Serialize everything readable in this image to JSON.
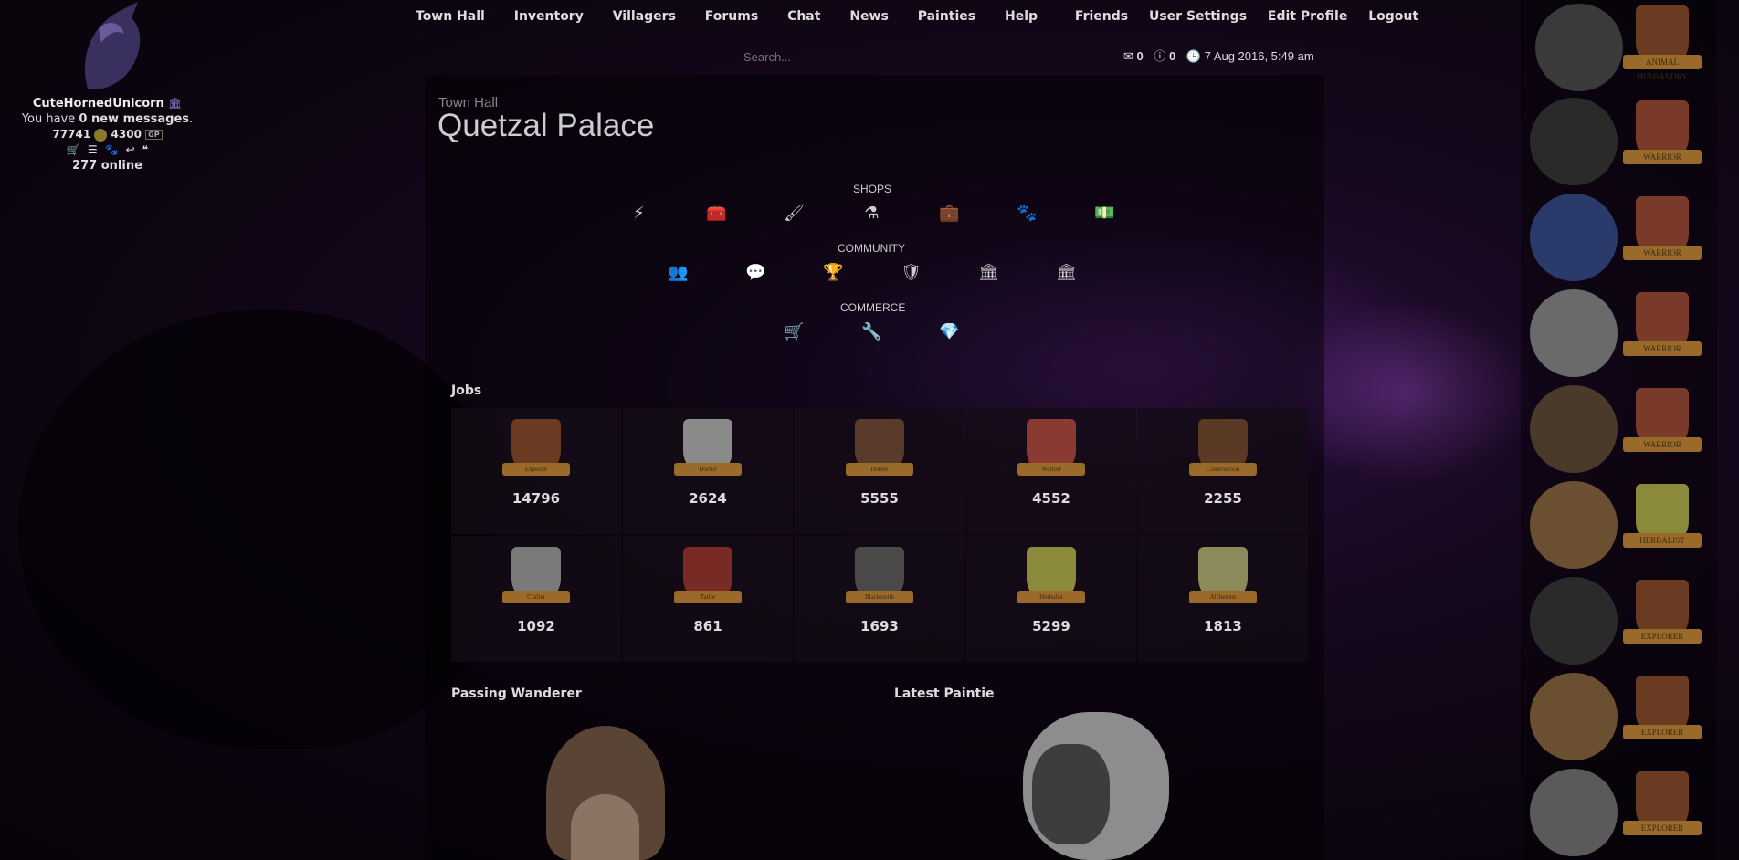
{
  "user_panel": {
    "username": "CuteHornedUnicorn",
    "messages_prefix": "You have ",
    "messages_bold": "0 new messages",
    "messages_suffix": ".",
    "coins": "77741",
    "gems": "4300",
    "gem_badge": "GP",
    "online": "277 online"
  },
  "nav": {
    "items": [
      "Town Hall",
      "Inventory",
      "Villagers",
      "Forums",
      "Chat",
      "News",
      "Painties",
      "Help"
    ],
    "right_items": [
      "Friends",
      "User Settings",
      "Edit Profile",
      "Logout"
    ]
  },
  "search": {
    "placeholder": "Search..."
  },
  "status": {
    "mail_count": "0",
    "alert_count": "0",
    "datetime": "7 Aug 2016, 5:49 am"
  },
  "breadcrumb": "Town Hall",
  "title": "Quetzal Palace",
  "sections": {
    "shops": "SHOPS",
    "community": "COMMUNITY",
    "commerce": "COMMERCE"
  },
  "shop_icons": [
    "bolt-icon",
    "medkit-icon",
    "paintbrush-icon",
    "flask-icon",
    "briefcase-icon",
    "paw-icon",
    "money-icon"
  ],
  "community_icons": [
    "users-icon",
    "comment-icon",
    "trophy-icon",
    "shield-icon",
    "bank-icon",
    "bank-icon"
  ],
  "commerce_icons": [
    "cart-icon",
    "wrench-icon",
    "diamond-icon"
  ],
  "jobs": {
    "title": "Jobs",
    "items": [
      {
        "name": "Explorer",
        "count": "14796",
        "color": "#6a3a22"
      },
      {
        "name": "Doctor",
        "count": "2624",
        "color": "#8a8a8a"
      },
      {
        "name": "Hobby",
        "count": "5555",
        "color": "#5a3a2a"
      },
      {
        "name": "Warrior",
        "count": "4552",
        "color": "#8a3a30"
      },
      {
        "name": "Construction",
        "count": "2255",
        "color": "#5a3a25"
      },
      {
        "name": "Crafter",
        "count": "1092",
        "color": "#7a7a7a"
      },
      {
        "name": "Tailor",
        "count": "861",
        "color": "#7a2a25"
      },
      {
        "name": "Blacksmith",
        "count": "1693",
        "color": "#4a4a4a"
      },
      {
        "name": "Herbalist",
        "count": "5299",
        "color": "#8a8a3a"
      },
      {
        "name": "Alchemist",
        "count": "1813",
        "color": "#8a8a5a"
      }
    ]
  },
  "passing_wanderer": "Passing Wanderer",
  "latest_paintie": "Latest Paintie",
  "sidebar_badges": [
    "ANIMAL HUSBANDRY",
    "WARRIOR",
    "WARRIOR",
    "WARRIOR",
    "WARRIOR",
    "HERBALIST",
    "EXPLORER",
    "EXPLORER",
    "EXPLORER"
  ],
  "sidebar_portrait_colors": [
    "#3a3a3a",
    "#2a2a2a",
    "#2a3a6a",
    "#6a6a6a",
    "#4a3a2a",
    "#6a5030",
    "#2a2a2a",
    "#6a5030",
    "#5a5a5a"
  ]
}
